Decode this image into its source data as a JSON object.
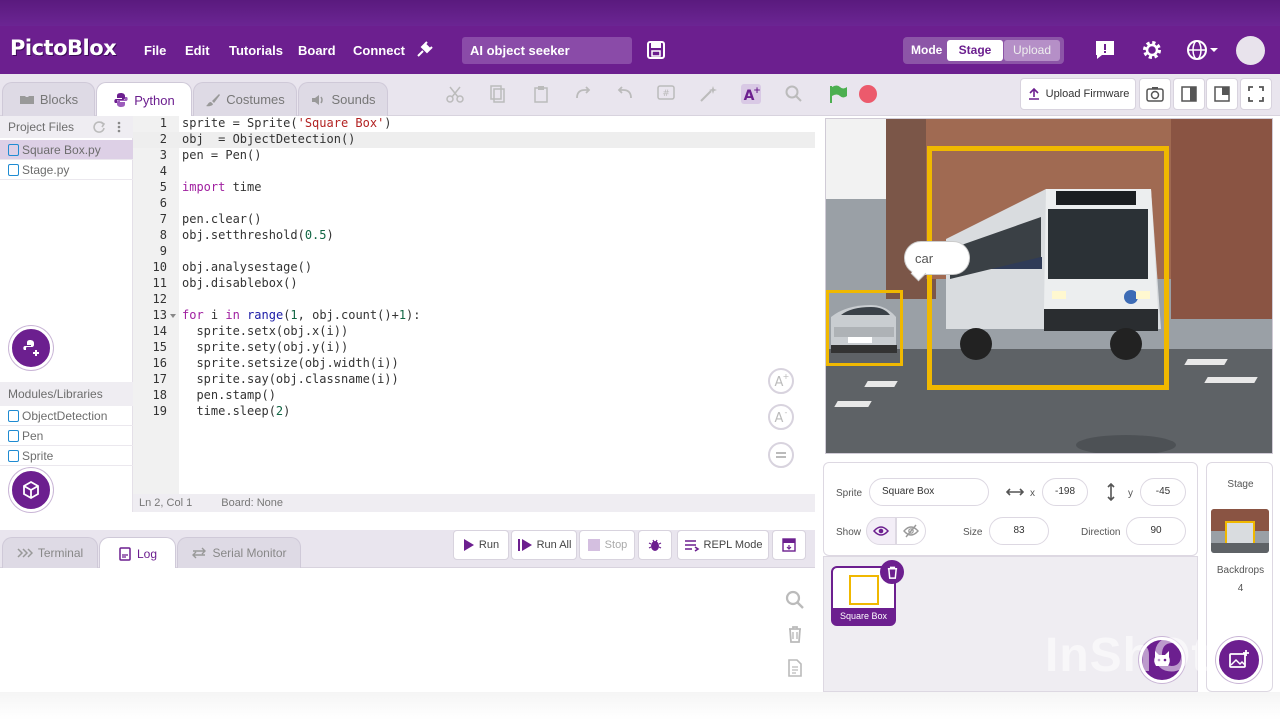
{
  "app": {
    "logo": "PictoBlox",
    "menu": [
      "File",
      "Edit",
      "Tutorials",
      "Board",
      "Connect"
    ],
    "project_name": "AI object seeker",
    "mode_label": "Mode",
    "mode_stage": "Stage",
    "mode_upload": "Upload",
    "accent": "#6c1f8f"
  },
  "tabs": {
    "blocks": "Blocks",
    "python": "Python",
    "costumes": "Costumes",
    "sounds": "Sounds"
  },
  "toolbar": {
    "upload_firmware": "Upload Firmware"
  },
  "files": {
    "header": "Project Files",
    "items": [
      "Square Box.py",
      "Stage.py"
    ],
    "modules_header": "Modules/Libraries",
    "modules": [
      "ObjectDetection",
      "Pen",
      "Sprite"
    ]
  },
  "editor": {
    "line_numbers": [
      "1",
      "2",
      "3",
      "4",
      "5",
      "6",
      "7",
      "8",
      "9",
      "10",
      "11",
      "12",
      "13",
      "14",
      "15",
      "16",
      "17",
      "18",
      "19"
    ],
    "status_position": "Ln 2, Col 1",
    "status_board": "Board: None"
  },
  "bottom": {
    "tabs": [
      "Terminal",
      "Log",
      "Serial Monitor"
    ],
    "run": "Run",
    "run_all": "Run All",
    "stop": "Stop",
    "repl": "REPL Mode"
  },
  "stage": {
    "bubble_text": "car"
  },
  "sprite": {
    "label": "Sprite",
    "name": "Square Box",
    "x_label": "x",
    "x_value": "-198",
    "y_label": "y",
    "y_value": "-45",
    "show_label": "Show",
    "size_label": "Size",
    "size_value": "83",
    "direction_label": "Direction",
    "direction_value": "90",
    "card_name": "Square Box"
  },
  "stage_panel": {
    "title": "Stage",
    "backdrops_label": "Backdrops",
    "backdrops_count": "4"
  },
  "watermark": "InShOt"
}
